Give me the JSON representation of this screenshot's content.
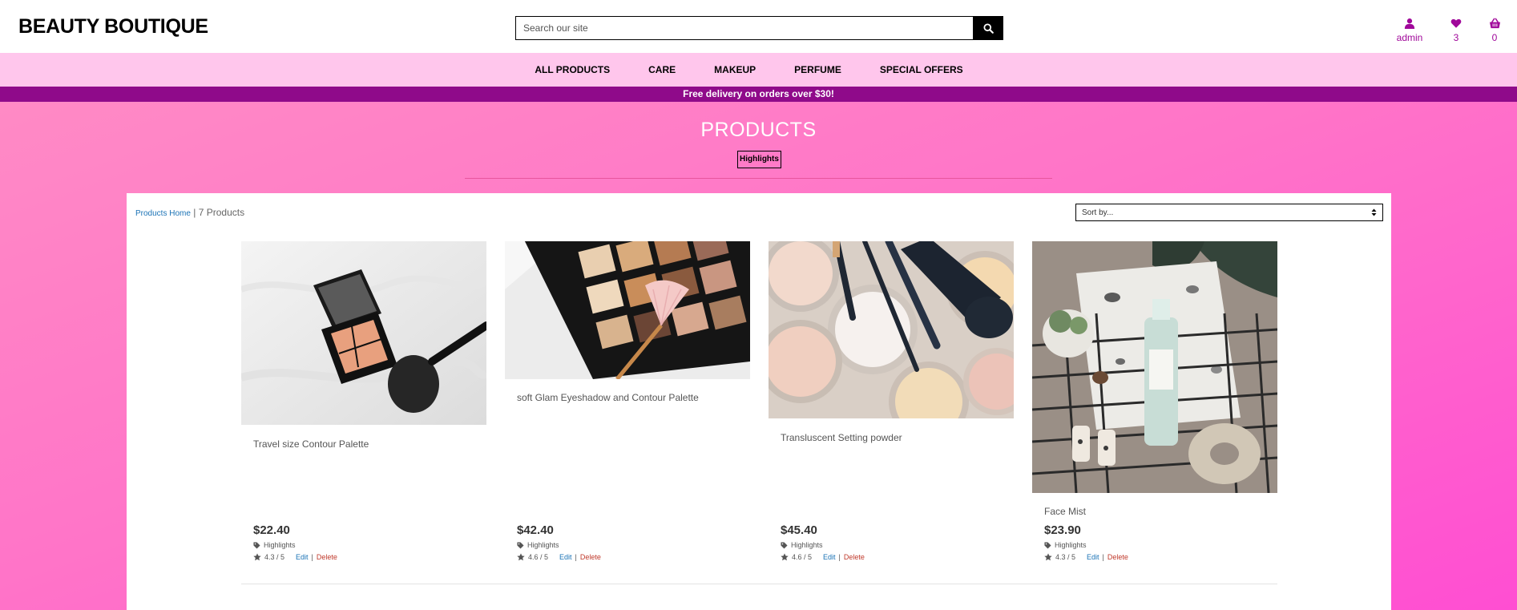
{
  "brand": {
    "name": "BEAUTY BOUTIQUE"
  },
  "search": {
    "placeholder": "Search our site",
    "icon": "search-icon"
  },
  "account": [
    {
      "label": "admin",
      "icon": "user-icon"
    },
    {
      "label": "3",
      "icon": "heart-icon"
    },
    {
      "label": "0",
      "icon": "basket-icon"
    }
  ],
  "nav": [
    "ALL PRODUCTS",
    "CARE",
    "MAKEUP",
    "PERFUME",
    "SPECIAL OFFERS"
  ],
  "banner": "Free delivery on orders over $30!",
  "page": {
    "heading": "PRODUCTS",
    "tag": "Highlights"
  },
  "toolbar": {
    "breadcrumb_link": "Products Home",
    "separator": " | ",
    "count": "7 Products",
    "sort_label": "Sort by..."
  },
  "products": [
    {
      "title": "Travel size Contour Palette",
      "price": "$22.40",
      "tag": "Highlights",
      "rating": "4.3 / 5",
      "edit": "Edit",
      "sep": "|",
      "delete": "Delete"
    },
    {
      "title": "soft Glam Eyeshadow and Contour Palette",
      "price": "$42.40",
      "tag": "Highlights",
      "rating": "4.6 / 5",
      "edit": "Edit",
      "sep": "|",
      "delete": "Delete"
    },
    {
      "title": "Transluscent Setting powder",
      "price": "$45.40",
      "tag": "Highlights",
      "rating": "4.6 / 5",
      "edit": "Edit",
      "sep": "|",
      "delete": "Delete"
    },
    {
      "title": "Face Mist",
      "price": "$23.90",
      "tag": "Highlights",
      "rating": "4.3 / 5",
      "edit": "Edit",
      "sep": "|",
      "delete": "Delete"
    }
  ],
  "colors": {
    "nav_bg": "#ffc6ec",
    "banner_bg": "#8f0a8a",
    "accent": "#a0089a",
    "hero_start": "#ff8ac5",
    "hero_end": "#ff4ed2",
    "link": "#1b73b6",
    "delete": "#c0392b"
  }
}
